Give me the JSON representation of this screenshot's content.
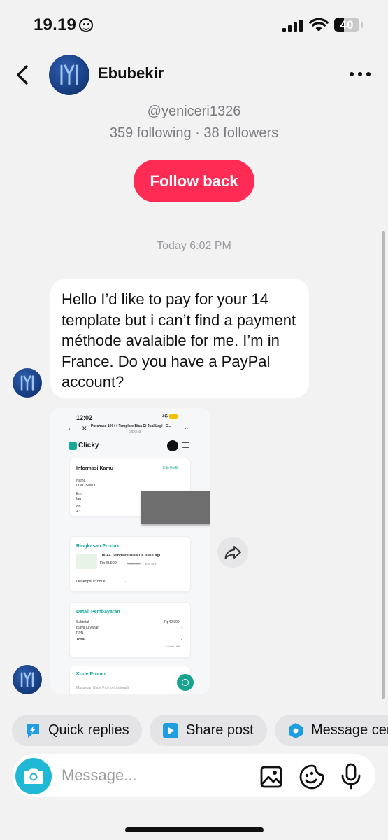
{
  "status_bar": {
    "time": "19.19",
    "battery_level": "40",
    "battery_fraction": 0.4
  },
  "header": {
    "name": "Ebubekir"
  },
  "profile": {
    "handle": "@yeniceri1326",
    "stats": "359 following · 38 followers",
    "follow_button": "Follow back"
  },
  "thread": {
    "timestamp": "Today 6:02 PM",
    "message_text": "Hello I’d like to pay for your 14 template but i can’t find a payment méthode avalaible for me. I’m in France. Do you have a PayPal account?"
  },
  "shared_screenshot": {
    "time": "12:02",
    "network": "4G",
    "page_title": "Purchase 100++ Template Bisa Di Jual Lagi | C...",
    "url": "clicky.id",
    "brand": "Clicky",
    "section_info": "Informasi Kamu",
    "edit_profile": "Edit Profil",
    "name_label": "Nama",
    "name_value": "LIMOSINO",
    "email_label": "Em",
    "email_value": "lau",
    "phone_label": "No.",
    "phone_value": "+3",
    "section_product": "Ringkasan Produk",
    "product_name": "100++ Template Bisa Di Jual Lagi",
    "price": "Rp49.999",
    "old_price": "Rp250.000",
    "discount": "80% OFF",
    "product_desc": "Deskripsi Produk",
    "section_payment": "Detail Pembayaran",
    "subtotal_label": "Subtotal",
    "subtotal_value": "Rp49.999",
    "fee_label": "Biaya Layanan",
    "fee_value": "-",
    "tax_label": "PPN",
    "tax_value": "-",
    "total_label": "Total",
    "total_value": "-",
    "unique_code": "+ Kode Unik",
    "section_promo": "Kode Promo",
    "promo_placeholder": "Masukkan Kode Promo (opsional)"
  },
  "quick_actions": [
    {
      "label": "Quick replies",
      "icon": "lightning-bubble-icon",
      "color": "#1e9de0"
    },
    {
      "label": "Share post",
      "icon": "play-square-icon",
      "color": "#1e9de0"
    },
    {
      "label": "Message cen",
      "icon": "hexagon-icon",
      "color": "#1e9de0"
    }
  ],
  "composer": {
    "placeholder": "Message..."
  },
  "colors": {
    "accent": "#fe2c55",
    "camera": "#20b8d4",
    "background": "#f2f2f3"
  }
}
